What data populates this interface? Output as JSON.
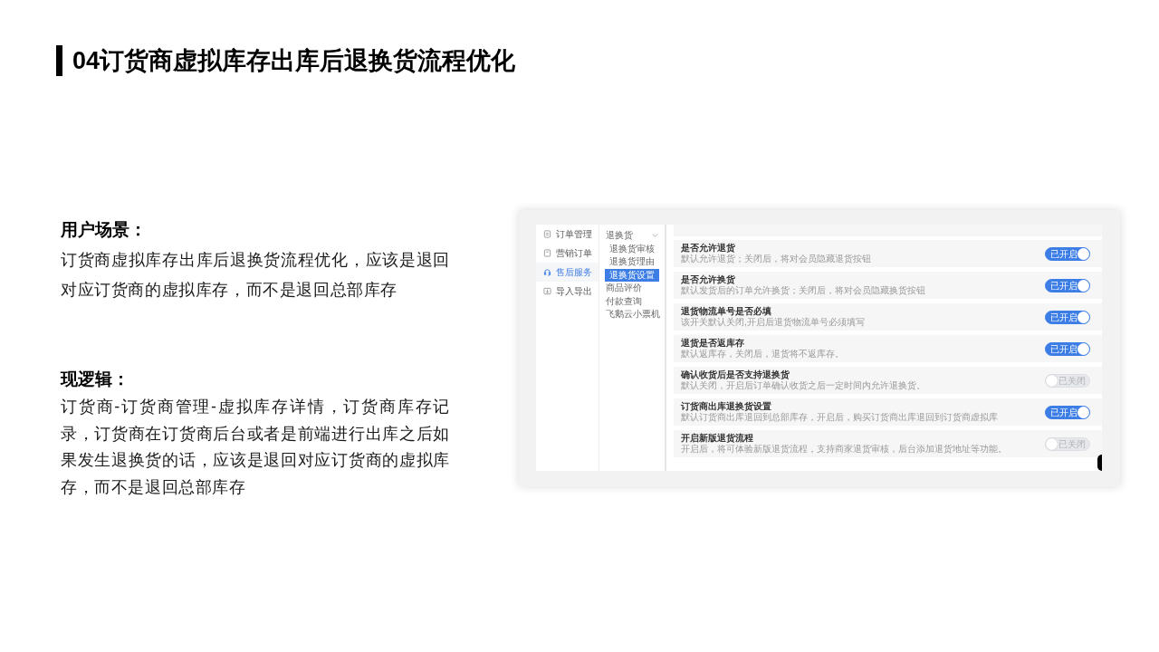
{
  "slide": {
    "title": "04订货商虚拟库存出库后退换货流程优化"
  },
  "sections": [
    {
      "heading": "用户场景：",
      "body": "订货商虚拟库存出库后退换货流程优化，应该是退回对应订货商的虚拟库存，而不是退回总部库存"
    },
    {
      "heading": "现逻辑：",
      "body": "订货商-订货商管理-虚拟库存详情，订货商库存记录，订货商在订货商后台或者是前端进行出库之后如果发生退换货的话，应该是退回对应订货商的虚拟库存，而不是退回总部库存"
    }
  ],
  "screenshot": {
    "sidebar": {
      "items": [
        {
          "label": "订单管理",
          "selected": false
        },
        {
          "label": "营销订单",
          "selected": false
        },
        {
          "label": "售后服务",
          "selected": true
        },
        {
          "label": "导入导出",
          "selected": false
        }
      ]
    },
    "submenu": {
      "items": [
        {
          "label": "退换货",
          "selected": false,
          "expanded": true,
          "children": [
            {
              "label": "退换货审核",
              "selected": false
            },
            {
              "label": "退换货理由",
              "selected": false
            },
            {
              "label": "退换货设置",
              "selected": true
            }
          ]
        },
        {
          "label": "商品评价",
          "selected": false
        },
        {
          "label": "付款查询",
          "selected": false
        },
        {
          "label": "飞鹅云小票机",
          "selected": false
        }
      ]
    },
    "settings": [
      {
        "title": "是否允许退货",
        "description": "默认允许退货；关闭后，将对会员隐藏退货按钮",
        "on": true,
        "toggle_label": "已开启"
      },
      {
        "title": "是否允许换货",
        "description": "默认发货后的订单允许换货；关闭后，将对会员隐藏换货按钮",
        "on": true,
        "toggle_label": "已开启"
      },
      {
        "title": "退货物流单号是否必填",
        "description": "该开关默认关闭,开启后退货物流单号必须填写",
        "on": true,
        "toggle_label": "已开启"
      },
      {
        "title": "退货是否返库存",
        "description": "默认返库存，关闭后，退货将不返库存。",
        "on": true,
        "toggle_label": "已开启"
      },
      {
        "title": "确认收货后是否支持退换货",
        "description": "默认关闭，开启后订单确认收货之后一定时间内允许退换货。",
        "on": false,
        "toggle_label": "已关闭"
      },
      {
        "title": "订货商出库退换货设置",
        "description": "默认订货商出库退回到总部库存，开启后，购买订货商出库退回到订货商虚拟库",
        "on": true,
        "toggle_label": "已开启"
      },
      {
        "title": "开启新版退货流程",
        "description": "开启后，将可体验新版退货流程，支持商家退货审核，后台添加退货地址等功能。",
        "on": false,
        "toggle_label": "已关闭"
      }
    ]
  }
}
